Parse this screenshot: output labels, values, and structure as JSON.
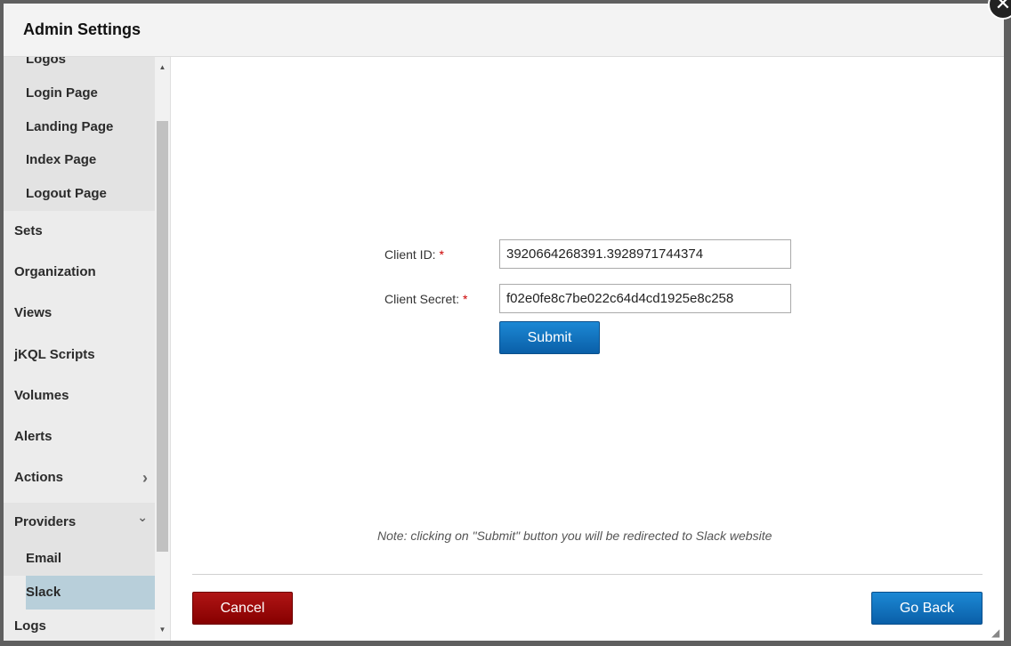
{
  "dialog": {
    "title": "Admin Settings",
    "close_symbol": "✕"
  },
  "sidebar": {
    "items": [
      {
        "label": "Logos",
        "level": "sub"
      },
      {
        "label": "Login Page",
        "level": "sub"
      },
      {
        "label": "Landing Page",
        "level": "sub"
      },
      {
        "label": "Index Page",
        "level": "sub"
      },
      {
        "label": "Logout Page",
        "level": "sub"
      },
      {
        "label": "Sets",
        "level": "top"
      },
      {
        "label": "Organization",
        "level": "top"
      },
      {
        "label": "Views",
        "level": "top"
      },
      {
        "label": "jKQL Scripts",
        "level": "top"
      },
      {
        "label": "Volumes",
        "level": "top"
      },
      {
        "label": "Alerts",
        "level": "top"
      },
      {
        "label": "Actions",
        "level": "top",
        "chevron": "›"
      },
      {
        "label": "Providers",
        "level": "top",
        "chevron": "⌄"
      },
      {
        "label": "Email",
        "level": "sub"
      },
      {
        "label": "Slack",
        "level": "sub",
        "active": true
      },
      {
        "label": "Logs",
        "level": "top"
      }
    ]
  },
  "form": {
    "client_id_label": "Client ID:",
    "client_id_value": "3920664268391.3928971744374",
    "client_secret_label": "Client Secret:",
    "client_secret_value": "f02e0fe8c7be022c64d4cd1925e8c258",
    "required_mark": "*",
    "submit_label": "Submit"
  },
  "note": "Note: clicking on \"Submit\" button you will be redirected to Slack website",
  "footer": {
    "cancel_label": "Cancel",
    "go_back_label": "Go Back"
  },
  "icons": {
    "scroll_up": "▲",
    "scroll_down": "▼",
    "resize_grip": "◢"
  },
  "colors": {
    "primary": "#0a6fbf",
    "danger": "#990000",
    "active_nav": "#b8cfda"
  }
}
